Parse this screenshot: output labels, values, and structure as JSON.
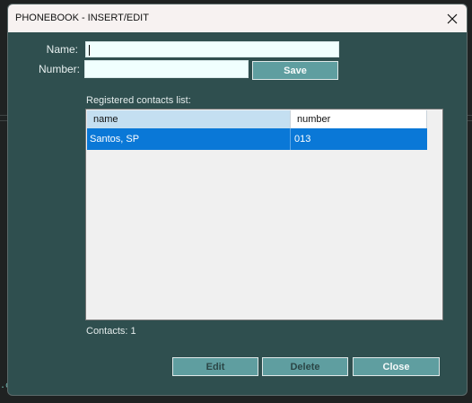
{
  "window": {
    "title": "PHONEBOOK - INSERT/EDIT"
  },
  "form": {
    "name_label": "Name:",
    "name_value": "",
    "number_label": "Number:",
    "number_value": "",
    "save_label": "Save"
  },
  "list": {
    "heading": "Registered contacts list:",
    "columns": [
      "name",
      "number"
    ],
    "rows": [
      {
        "name": "Santos, SP",
        "number": "013",
        "selected": true
      }
    ],
    "count_text": "Contacts: 1"
  },
  "actions": {
    "edit_label": "Edit",
    "delete_label": "Delete",
    "close_label": "Close"
  },
  "colors": {
    "window_bg": "#2f4f4f",
    "button_bg": "#5f9ea0",
    "selection": "#0a78d7",
    "header_active": "#c4dff1"
  },
  "icons": {
    "close": "close-icon"
  }
}
